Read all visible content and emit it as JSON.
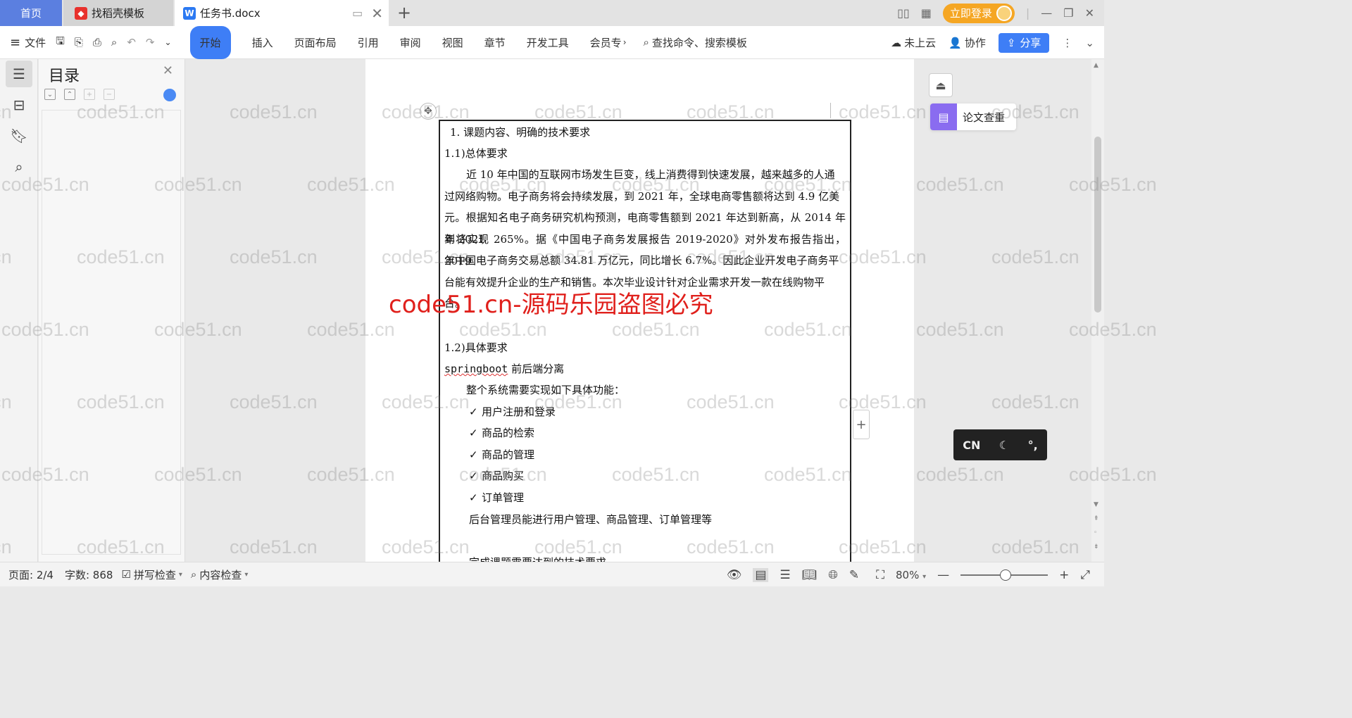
{
  "tabs": {
    "home": "首页",
    "template": "找稻壳模板",
    "doc": "任务书.docx",
    "template_icon": "docer-logo-icon",
    "doc_icon": "wps-writer-icon"
  },
  "title_right": {
    "login": "立即登录"
  },
  "ribbon": {
    "file": "文件",
    "tabs": [
      "开始",
      "插入",
      "页面布局",
      "引用",
      "审阅",
      "视图",
      "章节",
      "开发工具",
      "会员专"
    ],
    "search": "查找命令、搜索模板",
    "cloud": "未上云",
    "collab": "协作",
    "share": "分享"
  },
  "toc": {
    "title": "目录"
  },
  "document": {
    "heading1": "1. 课题内容、明确的技术要求",
    "sub1": "1.1)总体要求",
    "para1_lines": [
      "近 10 年中国的互联网市场发生巨变，线上消费得到快速发展，越来越多的人通",
      "过网络购物。电子商务将会持续发展，到 2021 年，全球电商零售额将达到 4.9 亿美",
      "元。根据知名电子商务研究机构预测，电商零售额到 2021 年达到新高，从 2014 年到 2021",
      "年将实现 265%。据《中国电子商务发展报告 2019-2020》对外发布报告指出，2019",
      "年中国电子商务交易总额 34.81 万亿元，同比增长 6.7%。因此企业开发电子商务平",
      "台能有效提升企业的生产和销售。本次毕业设计针对企业需求开发一款在线购物平",
      "台。"
    ],
    "sub2": "1.2)具体要求",
    "tech_word": "springboot",
    "tech_rest": " 前后端分离",
    "intro": "整个系统需要实现如下具体功能：",
    "features": [
      "用户注册和登录",
      "商品的检索",
      "商品的管理",
      "商品购买",
      "订单管理"
    ],
    "admin": "后台管理员能进行用户管理、商品管理、订单管理等",
    "next": "完成课题需要达到的技术要求"
  },
  "watermark": {
    "text": "code51.cn",
    "red": "code51.cn-源码乐园盗图必究"
  },
  "side_tools": {
    "paper_check": "论文查重",
    "ime_lang": "CN"
  },
  "status": {
    "page": "页面: 2/4",
    "words": "字数: 868",
    "spell": "拼写检查",
    "content": "内容检查",
    "zoom": "80%",
    "zoom_level": 80
  }
}
